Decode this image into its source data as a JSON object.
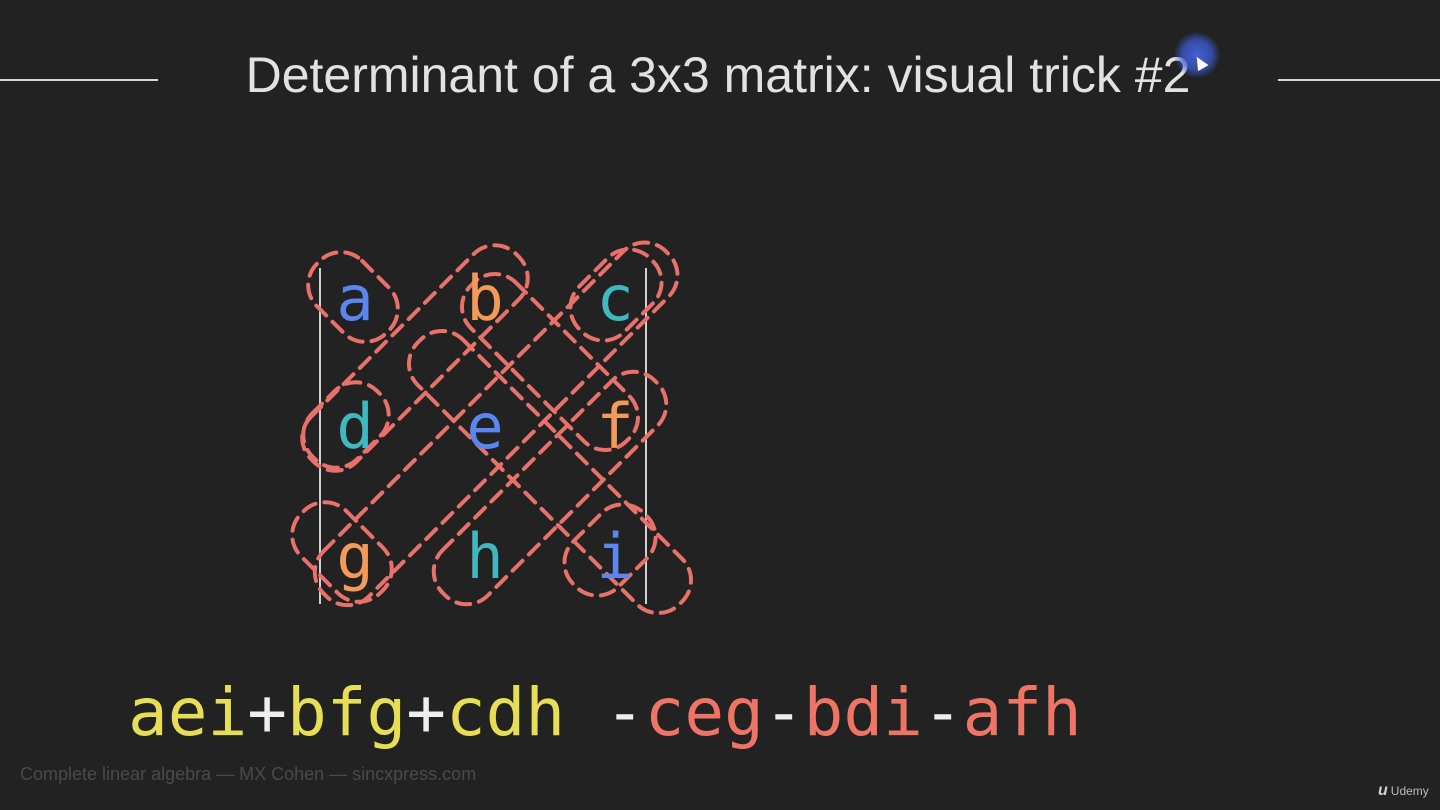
{
  "slide": {
    "title": "Determinant of a 3x3 matrix: visual trick #2",
    "footer": "Complete linear algebra — MX Cohen — sincxpress.com",
    "brand": "Udemy"
  },
  "colors": {
    "background": "#222222",
    "blue": "#5b86f0",
    "orange": "#f39a5a",
    "teal": "#3fb8bf",
    "dash": "#e8716a",
    "yellow": "#e6df55",
    "salmon": "#ee7566",
    "white": "#eeeeee"
  },
  "matrix": {
    "cells": [
      {
        "label": "a",
        "color": "blue"
      },
      {
        "label": "b",
        "color": "orange"
      },
      {
        "label": "c",
        "color": "teal"
      },
      {
        "label": "d",
        "color": "teal"
      },
      {
        "label": "e",
        "color": "blue"
      },
      {
        "label": "f",
        "color": "orange"
      },
      {
        "label": "g",
        "color": "orange"
      },
      {
        "label": "h",
        "color": "teal"
      },
      {
        "label": "i",
        "color": "blue"
      }
    ]
  },
  "formula": {
    "positive": [
      {
        "text": "aei",
        "color": "yellow"
      },
      {
        "text": "+",
        "color": "white"
      },
      {
        "text": "bfg",
        "color": "yellow"
      },
      {
        "text": "+",
        "color": "white"
      },
      {
        "text": "cdh",
        "color": "yellow"
      }
    ],
    "negative": [
      {
        "text": " -",
        "color": "white"
      },
      {
        "text": "ceg",
        "color": "salmon"
      },
      {
        "text": "-",
        "color": "white"
      },
      {
        "text": "bdi",
        "color": "salmon"
      },
      {
        "text": "-",
        "color": "white"
      },
      {
        "text": "afh",
        "color": "salmon"
      }
    ]
  }
}
